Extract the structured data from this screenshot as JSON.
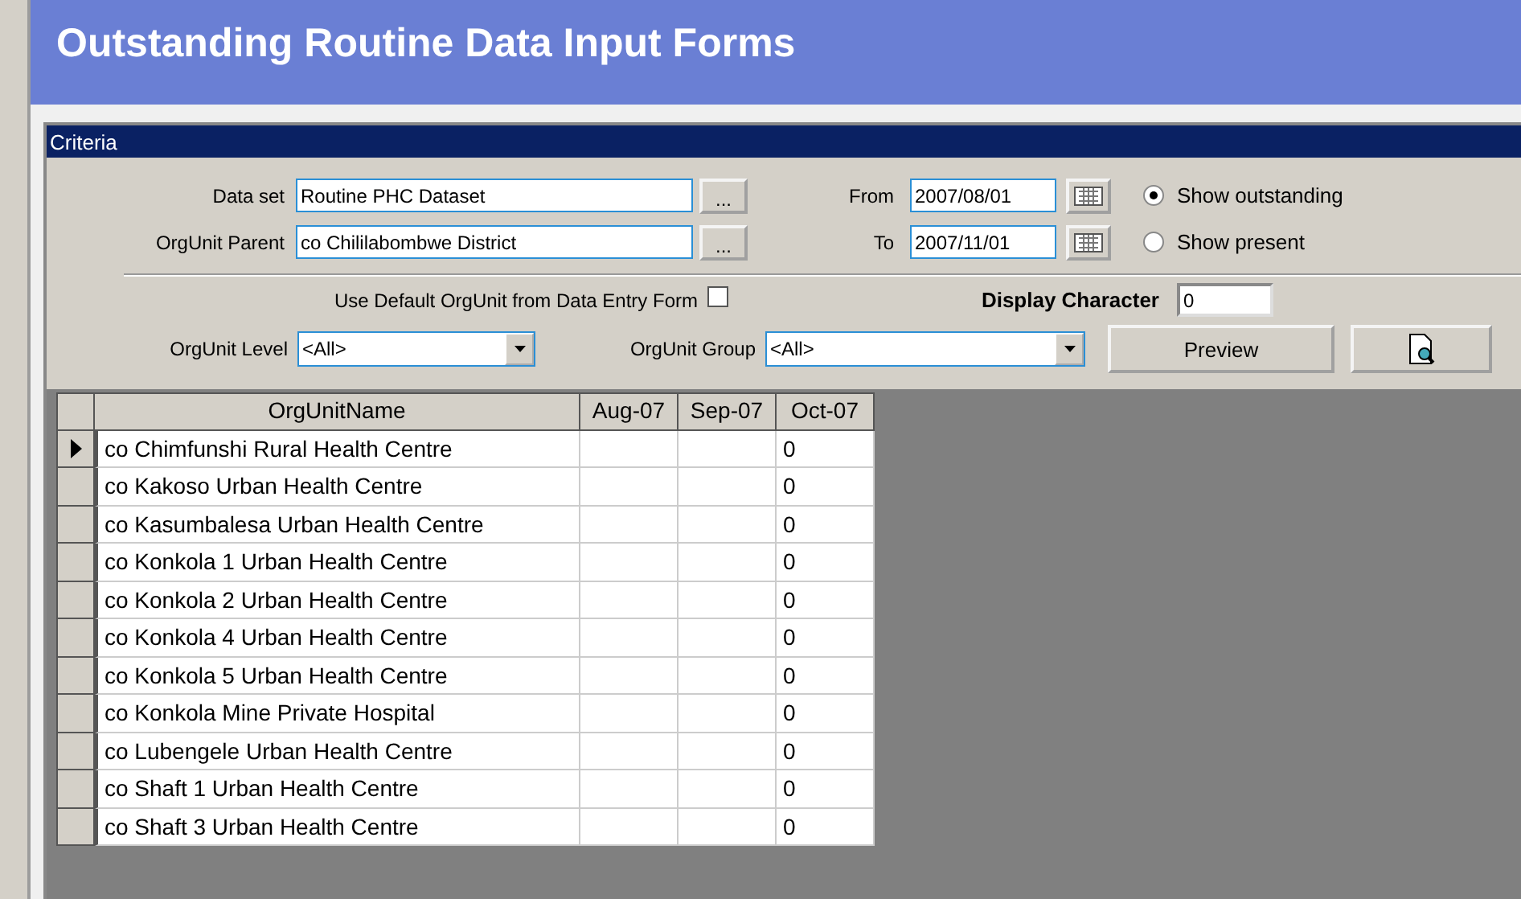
{
  "window": {
    "title": "Outstanding Routine Data Input Forms"
  },
  "criteria": {
    "heading": "Criteria",
    "data_set": {
      "label": "Data set",
      "value": "Routine PHC Dataset",
      "browse": "..."
    },
    "orgunit_parent": {
      "label": "OrgUnit Parent",
      "value": "co Chililabombwe District",
      "browse": "..."
    },
    "from": {
      "label": "From",
      "value": "2007/08/01"
    },
    "to": {
      "label": "To",
      "value": "2007/11/01"
    },
    "show_options": [
      {
        "label": "Show outstanding",
        "selected": true
      },
      {
        "label": "Show present",
        "selected": false
      }
    ],
    "use_default": {
      "label": "Use Default OrgUnit from Data Entry Form",
      "checked": false
    },
    "display_character": {
      "label": "Display Character",
      "value": "0"
    },
    "orgunit_level": {
      "label": "OrgUnit Level",
      "value": "<All>"
    },
    "orgunit_group": {
      "label": "OrgUnit Group",
      "value": "<All>"
    },
    "preview_button": "Preview"
  },
  "table": {
    "columns": [
      "OrgUnitName",
      "Aug-07",
      "Sep-07",
      "Oct-07"
    ],
    "rows": [
      {
        "current": true,
        "cells": [
          "co Chimfunshi Rural Health Centre",
          "",
          "",
          "0"
        ]
      },
      {
        "current": false,
        "cells": [
          "co Kakoso Urban Health Centre",
          "",
          "",
          "0"
        ]
      },
      {
        "current": false,
        "cells": [
          "co Kasumbalesa Urban Health Centre",
          "",
          "",
          "0"
        ]
      },
      {
        "current": false,
        "cells": [
          "co Konkola 1 Urban Health Centre",
          "",
          "",
          "0"
        ]
      },
      {
        "current": false,
        "cells": [
          "co Konkola 2 Urban Health Centre",
          "",
          "",
          "0"
        ]
      },
      {
        "current": false,
        "cells": [
          "co Konkola 4 Urban Health Centre",
          "",
          "",
          "0"
        ]
      },
      {
        "current": false,
        "cells": [
          "co Konkola 5 Urban Health Centre",
          "",
          "",
          "0"
        ]
      },
      {
        "current": false,
        "cells": [
          "co Konkola Mine Private Hospital",
          "",
          "",
          "0"
        ]
      },
      {
        "current": false,
        "cells": [
          "co Lubengele Urban Health Centre",
          "",
          "",
          "0"
        ]
      },
      {
        "current": false,
        "cells": [
          "co Shaft 1 Urban Health Centre",
          "",
          "",
          "0"
        ]
      },
      {
        "current": false,
        "cells": [
          "co Shaft 3 Urban Health Centre",
          "",
          "",
          "0"
        ]
      }
    ]
  }
}
